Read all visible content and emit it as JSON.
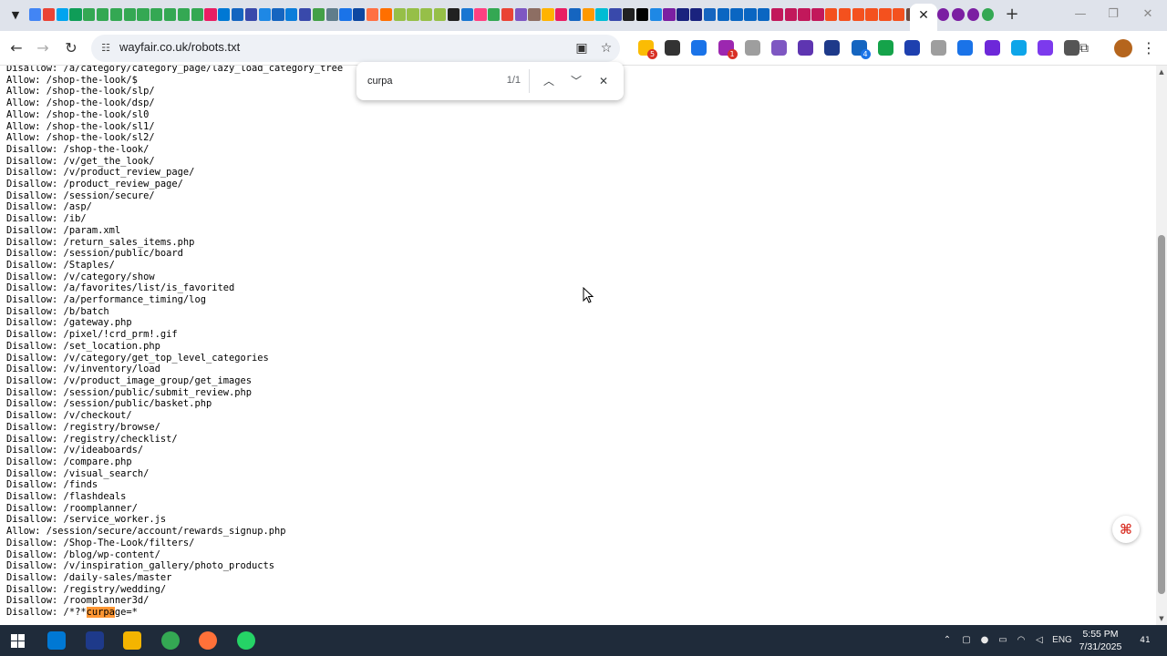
{
  "browser": {
    "tab_favicon_colors": [
      "#4285f4",
      "#ea4335",
      "#00a4ef",
      "#0f9d58",
      "#34a853",
      "#34a853",
      "#34a853",
      "#34a853",
      "#34a853",
      "#34a853",
      "#34a853",
      "#34a853",
      "#34a853",
      "#e91e63",
      "#0078d4",
      "#1565c0",
      "#3949ab",
      "#1e88e5",
      "#1565c0",
      "#0b7dda",
      "#3949ab",
      "#43a047",
      "#607d8b",
      "#1a73e8",
      "#0d47a1",
      "#ff7043",
      "#ff6f00",
      "#96bf48",
      "#96bf48",
      "#96bf48",
      "#96bf48",
      "#212121",
      "#1976d2",
      "#ff4081",
      "#34a853",
      "#ea4335",
      "#7e57c2",
      "#8d6e63",
      "#ffb300",
      "#e91e63",
      "#1565c0",
      "#ff9800",
      "#00bcd4",
      "#3949ab",
      "#212121",
      "#000000",
      "#1e88e5",
      "#7b1fa2",
      "#1a237e",
      "#1a237e",
      "#1565c0",
      "#0a66c2",
      "#0a66c2",
      "#0a66c2",
      "#0a66c2",
      "#c2185b",
      "#c2185b",
      "#c2185b",
      "#c2185b",
      "#f4511e",
      "#f4511e",
      "#f4511e",
      "#f4511e",
      "#f4511e",
      "#f4511e",
      "#6d4c41",
      "#34a853"
    ],
    "active_tab_close": "✕",
    "extra_tab_colors": [
      "#7b1fa2",
      "#7b1fa2",
      "#7b1fa2",
      "#34a853"
    ],
    "new_tab": "+",
    "window_controls": {
      "minimize": "—",
      "maximize": "❐",
      "close": "✕"
    }
  },
  "toolbar": {
    "url": "wayfair.co.uk/robots.txt",
    "extensions": [
      {
        "color": "#fbbc04",
        "badge": "5"
      },
      {
        "color": "#333333",
        "badge": ""
      },
      {
        "color": "#1a73e8",
        "badge": ""
      },
      {
        "color": "#9c27b0",
        "badge": "1"
      },
      {
        "color": "#9e9e9e",
        "badge": ""
      },
      {
        "color": "#7e57c2",
        "badge": ""
      },
      {
        "color": "#5e35b1",
        "badge": ""
      },
      {
        "color": "#1e3a8a",
        "badge": ""
      },
      {
        "color": "#1565c0",
        "badge": "4"
      },
      {
        "color": "#15a34a",
        "badge": ""
      },
      {
        "color": "#1e40af",
        "badge": ""
      },
      {
        "color": "#9e9e9e",
        "badge": ""
      },
      {
        "color": "#1a73e8",
        "badge": ""
      },
      {
        "color": "#6d28d9",
        "badge": ""
      },
      {
        "color": "#0ea5e9",
        "badge": ""
      },
      {
        "color": "#7c3aed",
        "badge": ""
      },
      {
        "color": "#555555",
        "badge": ""
      }
    ]
  },
  "find": {
    "query": "curpa",
    "count": "1/1"
  },
  "robots": {
    "lines": [
      "Disallow: /a/category/category_page/lazy_load_category_tree",
      "Allow: /shop-the-look/$",
      "Allow: /shop-the-look/slp/",
      "Allow: /shop-the-look/dsp/",
      "Allow: /shop-the-look/sl0",
      "Allow: /shop-the-look/sl1/",
      "Allow: /shop-the-look/sl2/",
      "Disallow: /shop-the-look/",
      "Disallow: /v/get_the_look/",
      "Disallow: /v/product_review_page/",
      "Disallow: /product_review_page/",
      "Disallow: /session/secure/",
      "Disallow: /asp/",
      "Disallow: /ib/",
      "Disallow: /param.xml",
      "Disallow: /return_sales_items.php",
      "Disallow: /session/public/board",
      "Disallow: /Staples/",
      "Disallow: /v/category/show",
      "Disallow: /a/favorites/list/is_favorited",
      "Disallow: /a/performance_timing/log",
      "Disallow: /b/batch",
      "Disallow: /gateway.php",
      "Disallow: /pixel/!crd_prm!.gif",
      "Disallow: /set_location.php",
      "Disallow: /v/category/get_top_level_categories",
      "Disallow: /v/inventory/load",
      "Disallow: /v/product_image_group/get_images",
      "Disallow: /session/public/submit_review.php",
      "Disallow: /session/public/basket.php",
      "Disallow: /v/checkout/",
      "Disallow: /registry/browse/",
      "Disallow: /registry/checklist/",
      "Disallow: /v/ideaboards/",
      "Disallow: /compare.php",
      "Disallow: /visual_search/",
      "Disallow: /finds",
      "Disallow: /flashdeals",
      "Disallow: /roomplanner/",
      "Disallow: /service_worker.js",
      "Allow: /session/secure/account/rewards_signup.php",
      "Disallow: /Shop-The-Look/filters/",
      "Disallow: /blog/wp-content/",
      "Disallow: /v/inspiration_gallery/photo_products",
      "Disallow: /daily-sales/master",
      "Disallow: /registry/wedding/",
      "Disallow: /roomplanner3d/"
    ],
    "last_line_prefix": "Disallow: /*?*",
    "last_line_match": "curpa",
    "last_line_suffix": "ge=*"
  },
  "taskbar": {
    "language": "ENG",
    "time": "5:55 PM",
    "date": "7/31/2025",
    "notifications": "41",
    "app_colors": [
      "#0078d4",
      "#1e3a8a",
      "#f4b400",
      "#34a853",
      "#ff7139",
      "#25d366"
    ]
  }
}
